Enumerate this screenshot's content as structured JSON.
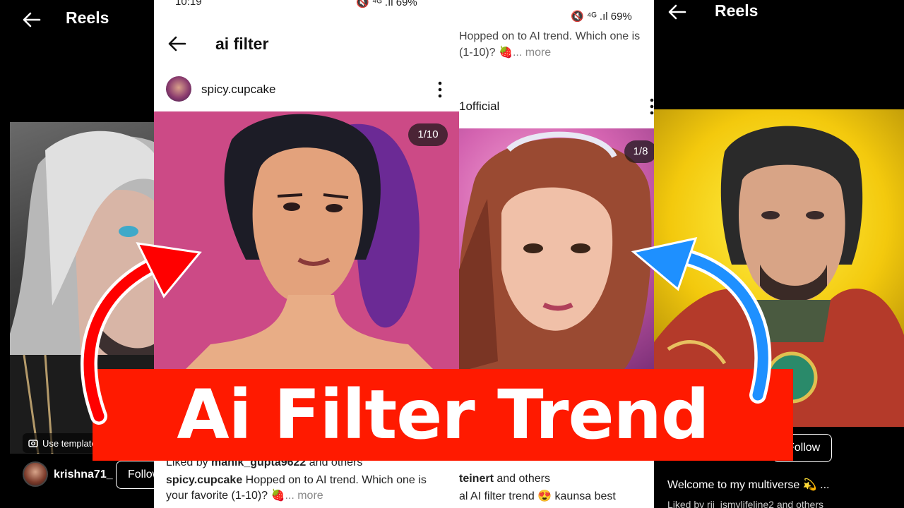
{
  "left_panel": {
    "title": "Reels",
    "use_template_label": "Use template",
    "username": "krishna71_",
    "follow_label": "Follow"
  },
  "center_panel": {
    "status_time": "10:19",
    "status_battery": "69%",
    "title": "ai filter",
    "username": "spicy.cupcake",
    "media_counter": "1/10",
    "liked_prefix": "Liked by",
    "liked_user": "manik_gupta9622",
    "liked_suffix": "and others",
    "caption_user": "spicy.cupcake",
    "caption_text": "Hopped on to AI trend. Which one is your favorite (1-10)? 🍓",
    "caption_more": "... more"
  },
  "right_post_panel": {
    "status_battery": "69%",
    "caption_top": "Hopped on to AI trend. Which one is (1-10)? 🍓",
    "caption_more": "... more",
    "username": "1official",
    "media_counter": "1/8",
    "liked_user": "teinert",
    "liked_suffix": "and others",
    "caption_bottom": "al AI filter trend 😍 kaunsa best"
  },
  "right_panel": {
    "title": "Reels",
    "follow_label": "Follow",
    "caption": "Welcome to my multiverse 💫 ...",
    "liked_text": "Liked by rii_ismylifeline2 and others"
  },
  "banner": {
    "text": "Ai Filter Trend",
    "color": "#ff1a00"
  },
  "arrows": {
    "left_color": "#ff0000",
    "right_color": "#1e90ff"
  },
  "icons": [
    "back-arrow-icon",
    "more-vert-icon",
    "camera-icon",
    "strawberry-emoji",
    "smile-emoji"
  ]
}
